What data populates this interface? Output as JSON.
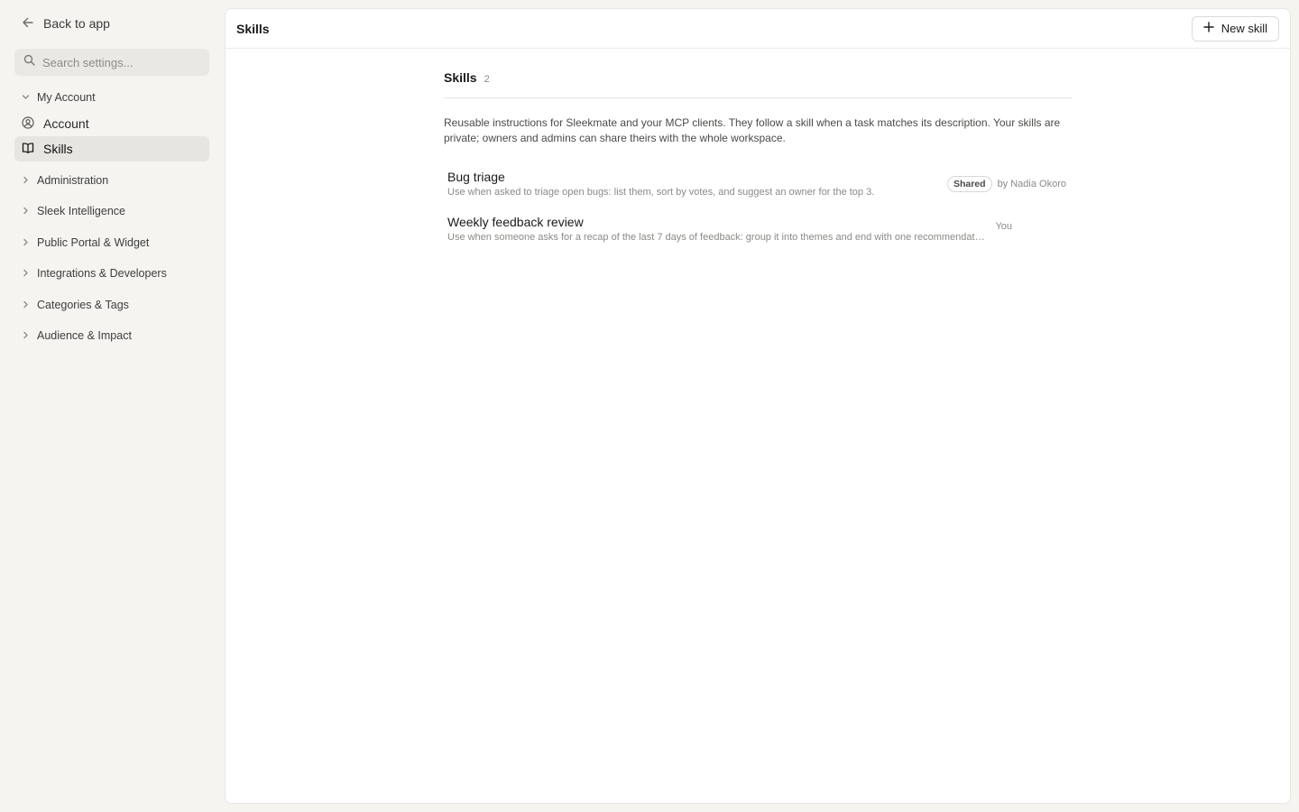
{
  "sidebar": {
    "back_label": "Back to app",
    "search_placeholder": "Search settings...",
    "my_account_label": "My Account",
    "items": [
      {
        "label": "Account",
        "icon": "user-circle-icon",
        "active": false
      },
      {
        "label": "Skills",
        "icon": "book-open-icon",
        "active": true
      }
    ],
    "groups": [
      "Administration",
      "Sleek Intelligence",
      "Public Portal & Widget",
      "Integrations & Developers",
      "Categories & Tags",
      "Audience & Impact"
    ]
  },
  "header": {
    "title": "Skills",
    "new_button_label": "New skill"
  },
  "skills_section": {
    "title": "Skills",
    "count": "2",
    "description": "Reusable instructions for Sleekmate and your MCP clients. They follow a skill when a task matches its description. Your skills are private; owners and admins can share theirs with the whole workspace.",
    "skills": [
      {
        "name": "Bug triage",
        "description": "Use when asked to triage open bugs: list them, sort by votes, and suggest an owner for the top 3.",
        "badge": "Shared",
        "owner": "by Nadia Okoro"
      },
      {
        "name": "Weekly feedback review",
        "description": "Use when someone asks for a recap of the last 7 days of feedback: group it into themes and end with one recommendation.",
        "badge": "",
        "owner": "You"
      }
    ]
  },
  "colors": {
    "background": "#f5f4f1",
    "panel": "#ffffff",
    "active_item": "#e6e5e1"
  }
}
